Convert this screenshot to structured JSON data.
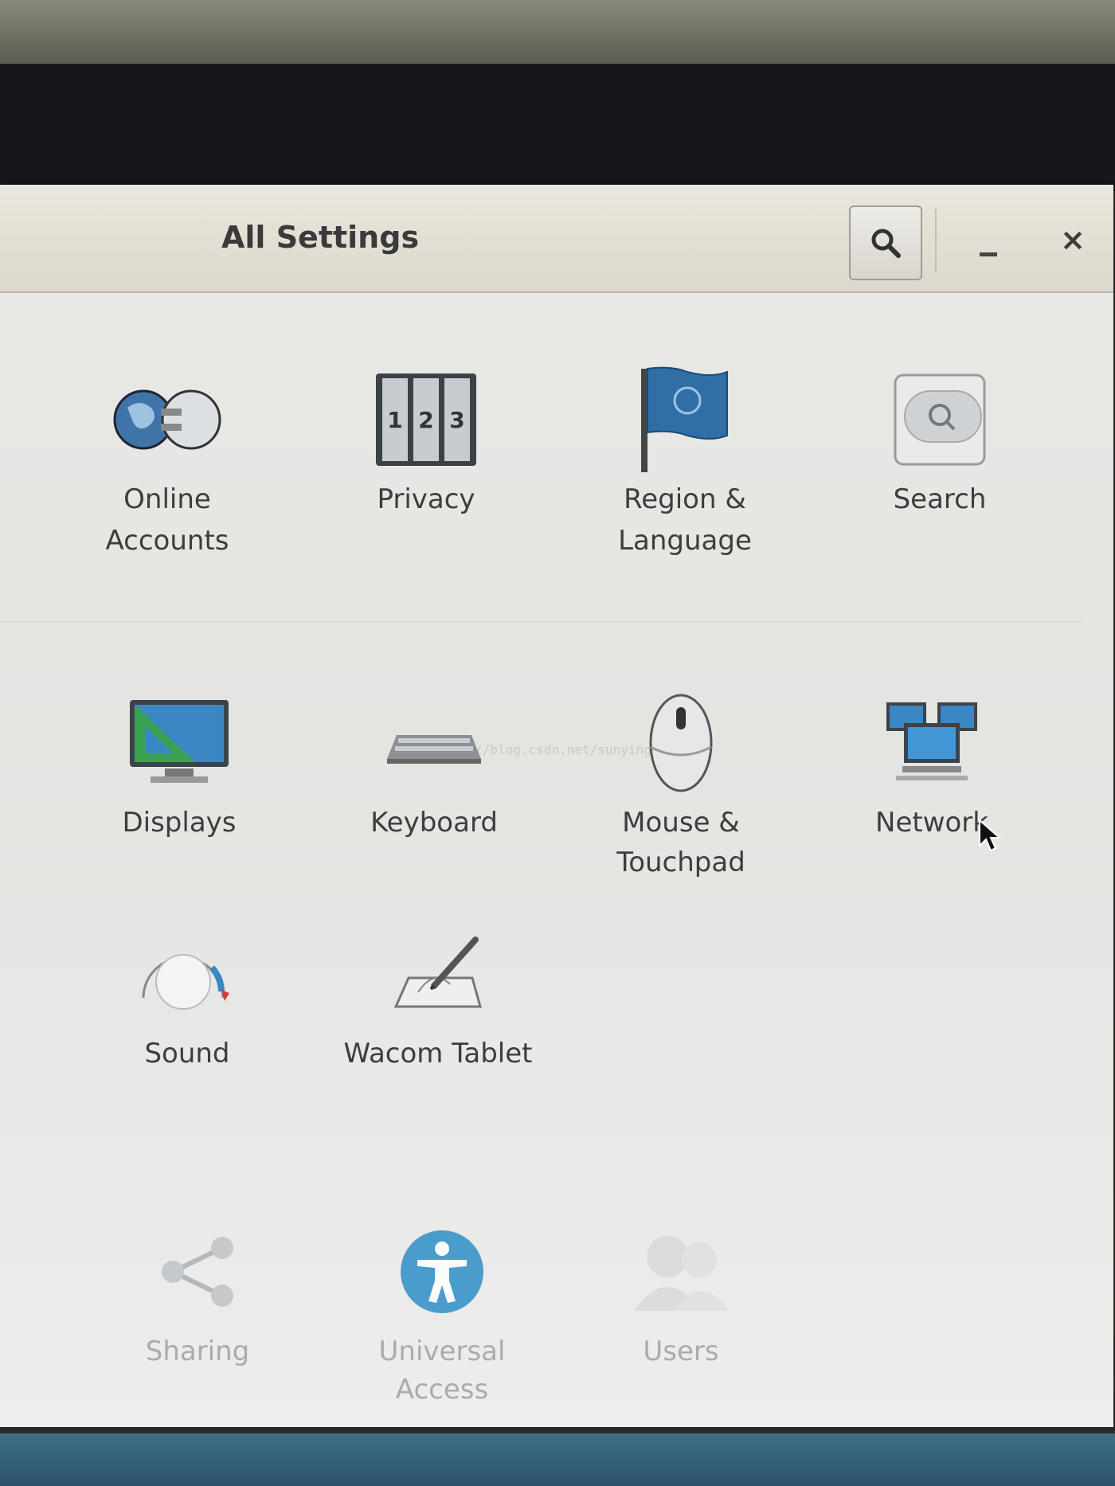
{
  "window": {
    "title": "All Settings",
    "search_button_icon": "search-icon",
    "minimize_icon": "minimize-icon",
    "close_symbol": "×"
  },
  "section_personal": [
    {
      "label_line1": "Online",
      "label_line2": "Accounts",
      "icon": "online-accounts-icon"
    },
    {
      "label_line1": "Privacy",
      "label_line2": "",
      "icon": "privacy-lock-icon"
    },
    {
      "label_line1": "Region &",
      "label_line2": "Language",
      "icon": "flag-icon"
    },
    {
      "label_line1": "Search",
      "label_line2": "",
      "icon": "search-app-icon"
    }
  ],
  "section_hardware": [
    {
      "label_line1": "Displays",
      "label_line2": "",
      "icon": "display-icon"
    },
    {
      "label_line1": "Keyboard",
      "label_line2": "",
      "icon": "keyboard-icon"
    },
    {
      "label_line1": "Mouse &",
      "label_line2": "Touchpad",
      "icon": "mouse-icon"
    },
    {
      "label_line1": "Network",
      "label_line2": "",
      "icon": "network-icon"
    },
    {
      "label_line1": "Sound",
      "label_line2": "",
      "icon": "sound-icon"
    },
    {
      "label_line1": "Wacom Tablet",
      "label_line2": "",
      "icon": "tablet-icon"
    }
  ],
  "section_system": [
    {
      "label_line1": "Sharing",
      "label_line2": "",
      "icon": "sharing-icon"
    },
    {
      "label_line1": "Universal",
      "label_line2": "Access",
      "icon": "universal-access-icon"
    },
    {
      "label_line1": "Users",
      "label_line2": "",
      "icon": "users-icon"
    }
  ],
  "watermark": "http://blog.csdn.net/sunyinggang",
  "colors": {
    "accent_blue": "#2f7fb5",
    "text": "#3d3d3d",
    "faded_text": "#a9acad"
  }
}
